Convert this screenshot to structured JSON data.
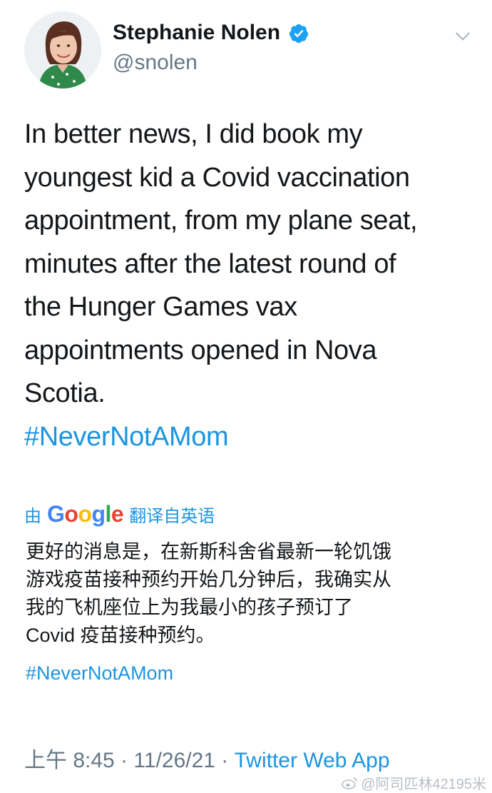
{
  "author": {
    "display_name": "Stephanie Nolen",
    "handle": "@snolen",
    "verified": true,
    "avatar_icon": "profile-photo"
  },
  "menu_icon": "chevron-down-icon",
  "tweet": {
    "text_lines": [
      "In better news, I did book my",
      "youngest kid a Covid vaccination",
      "appointment, from my plane seat,",
      "minutes after the latest round of",
      "the Hunger Games vax",
      "appointments opened in Nova",
      "Scotia."
    ],
    "hashtag": "#NeverNotAMom"
  },
  "translation": {
    "prefix": "由",
    "provider": "Google",
    "suffix": "翻译自英语",
    "text_lines": [
      "更好的消息是，在新斯科舍省最新一轮饥饿",
      "游戏疫苗接种预约开始几分钟后，我确实从",
      "我的飞机座位上为我最小的孩子预订了",
      "Covid 疫苗接种预约。"
    ],
    "hashtag": "#NeverNotAMom"
  },
  "meta": {
    "time": "上午 8:45",
    "separator": " · ",
    "date": "11/26/21",
    "source": "Twitter Web App"
  },
  "watermark": {
    "text": "@阿司匹林42195米"
  },
  "colors": {
    "link": "#1b95e0",
    "text": "#14171a",
    "secondary": "#657786",
    "verified": "#1da1f2"
  }
}
